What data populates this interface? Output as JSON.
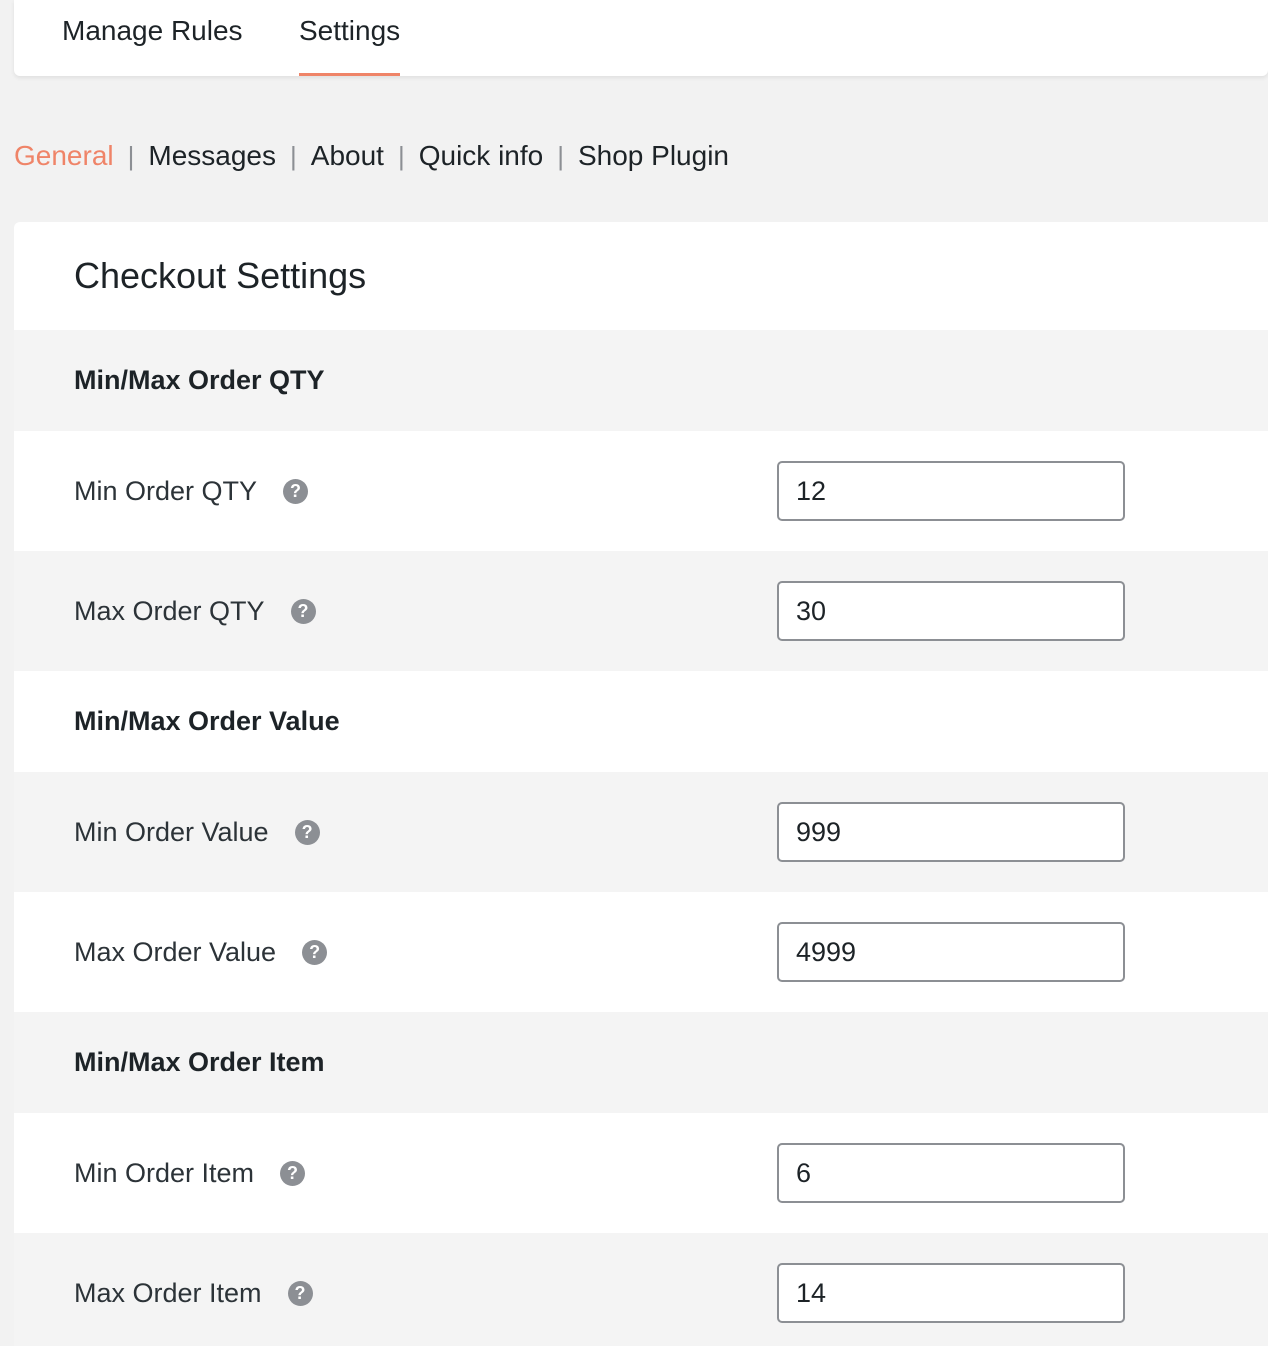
{
  "top_tabs": [
    {
      "label": "Manage Rules",
      "active": false
    },
    {
      "label": "Settings",
      "active": true
    }
  ],
  "sub_nav": {
    "items": [
      "General",
      "Messages",
      "About",
      "Quick info",
      "Shop Plugin"
    ],
    "active": "General",
    "separator": "|"
  },
  "panel": {
    "title": "Checkout Settings",
    "help_glyph": "?",
    "sections": [
      {
        "label": "Min/Max Order QTY",
        "fields": [
          {
            "label": "Min Order QTY",
            "value": "12"
          },
          {
            "label": "Max Order QTY",
            "value": "30"
          }
        ]
      },
      {
        "label": "Min/Max Order Value",
        "fields": [
          {
            "label": "Min Order Value",
            "value": "999"
          },
          {
            "label": "Max Order Value",
            "value": "4999"
          }
        ]
      },
      {
        "label": "Min/Max Order Item",
        "fields": [
          {
            "label": "Min Order Item",
            "value": "6"
          },
          {
            "label": "Max Order Item",
            "value": "14"
          }
        ]
      }
    ]
  },
  "colors": {
    "accent": "#ef8468",
    "help_icon": "#8c8f94",
    "row_alt": "#f4f4f4",
    "page_bg": "#f2f2f2"
  },
  "icons": {
    "help": "help-circle-icon"
  }
}
